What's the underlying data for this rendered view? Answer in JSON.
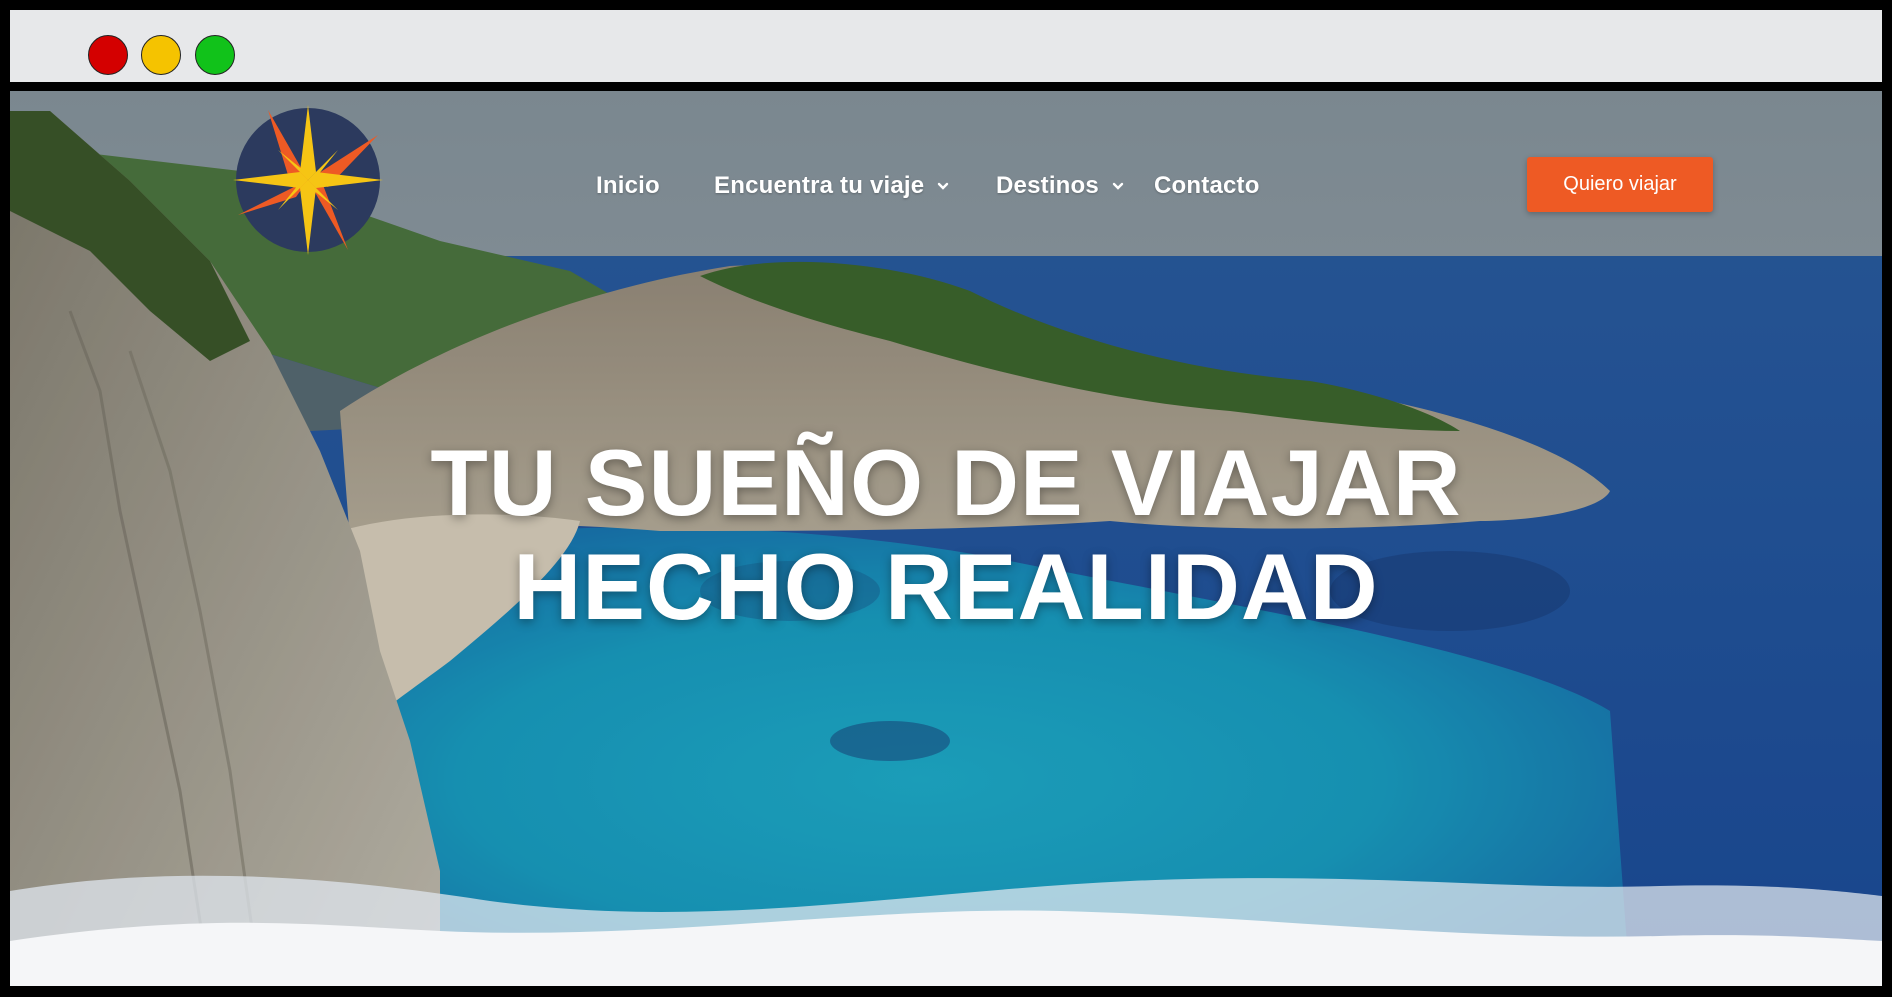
{
  "window": {
    "controls": [
      "close",
      "minimize",
      "maximize"
    ]
  },
  "header": {
    "logo": "compass-star-logo",
    "nav": [
      {
        "label": "Inicio",
        "dropdown": false
      },
      {
        "label": "Encuentra tu viaje",
        "dropdown": true
      },
      {
        "label": "Destinos",
        "dropdown": true
      },
      {
        "label": "Contacto",
        "dropdown": false
      }
    ],
    "cta_label": "Quiero viajar"
  },
  "hero": {
    "line1": "TU SUEÑO DE VIAJAR",
    "line2": "HECHO REALIDAD",
    "background": "coastal-cove-photo"
  },
  "colors": {
    "accent": "#ee5a24",
    "logo_navy": "#2c3a5e",
    "logo_orange": "#ee5a24",
    "logo_yellow": "#f6c514"
  }
}
